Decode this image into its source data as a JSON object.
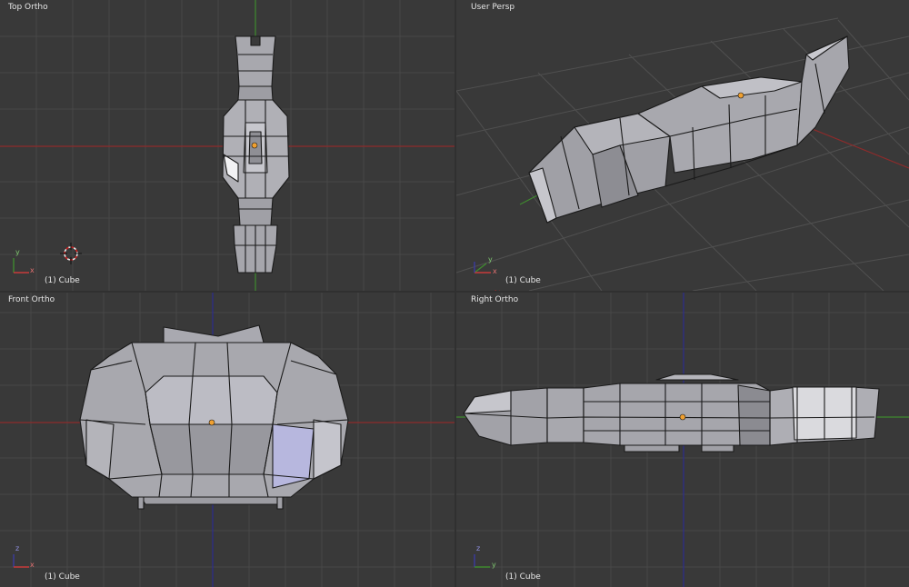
{
  "viewports": {
    "top": {
      "label": "Top Ortho",
      "object": "(1) Cube",
      "axes": [
        "y",
        "x"
      ]
    },
    "persp": {
      "label": "User Persp",
      "object": "(1) Cube",
      "axes": [
        "y",
        "x"
      ]
    },
    "front": {
      "label": "Front Ortho",
      "object": "(1) Cube",
      "axes": [
        "z",
        "x"
      ]
    },
    "right": {
      "label": "Right Ortho",
      "object": "(1) Cube",
      "axes": [
        "z",
        "y"
      ]
    }
  },
  "colors": {
    "background": "#393939",
    "grid": "#474747",
    "x_axis": "#8e2b2b",
    "y_axis": "#3f8a2f",
    "z_axis": "#2c2c8f",
    "mesh_face": "#a6a6ac",
    "mesh_edge": "#1a1a1a",
    "origin": "#f0a030"
  }
}
